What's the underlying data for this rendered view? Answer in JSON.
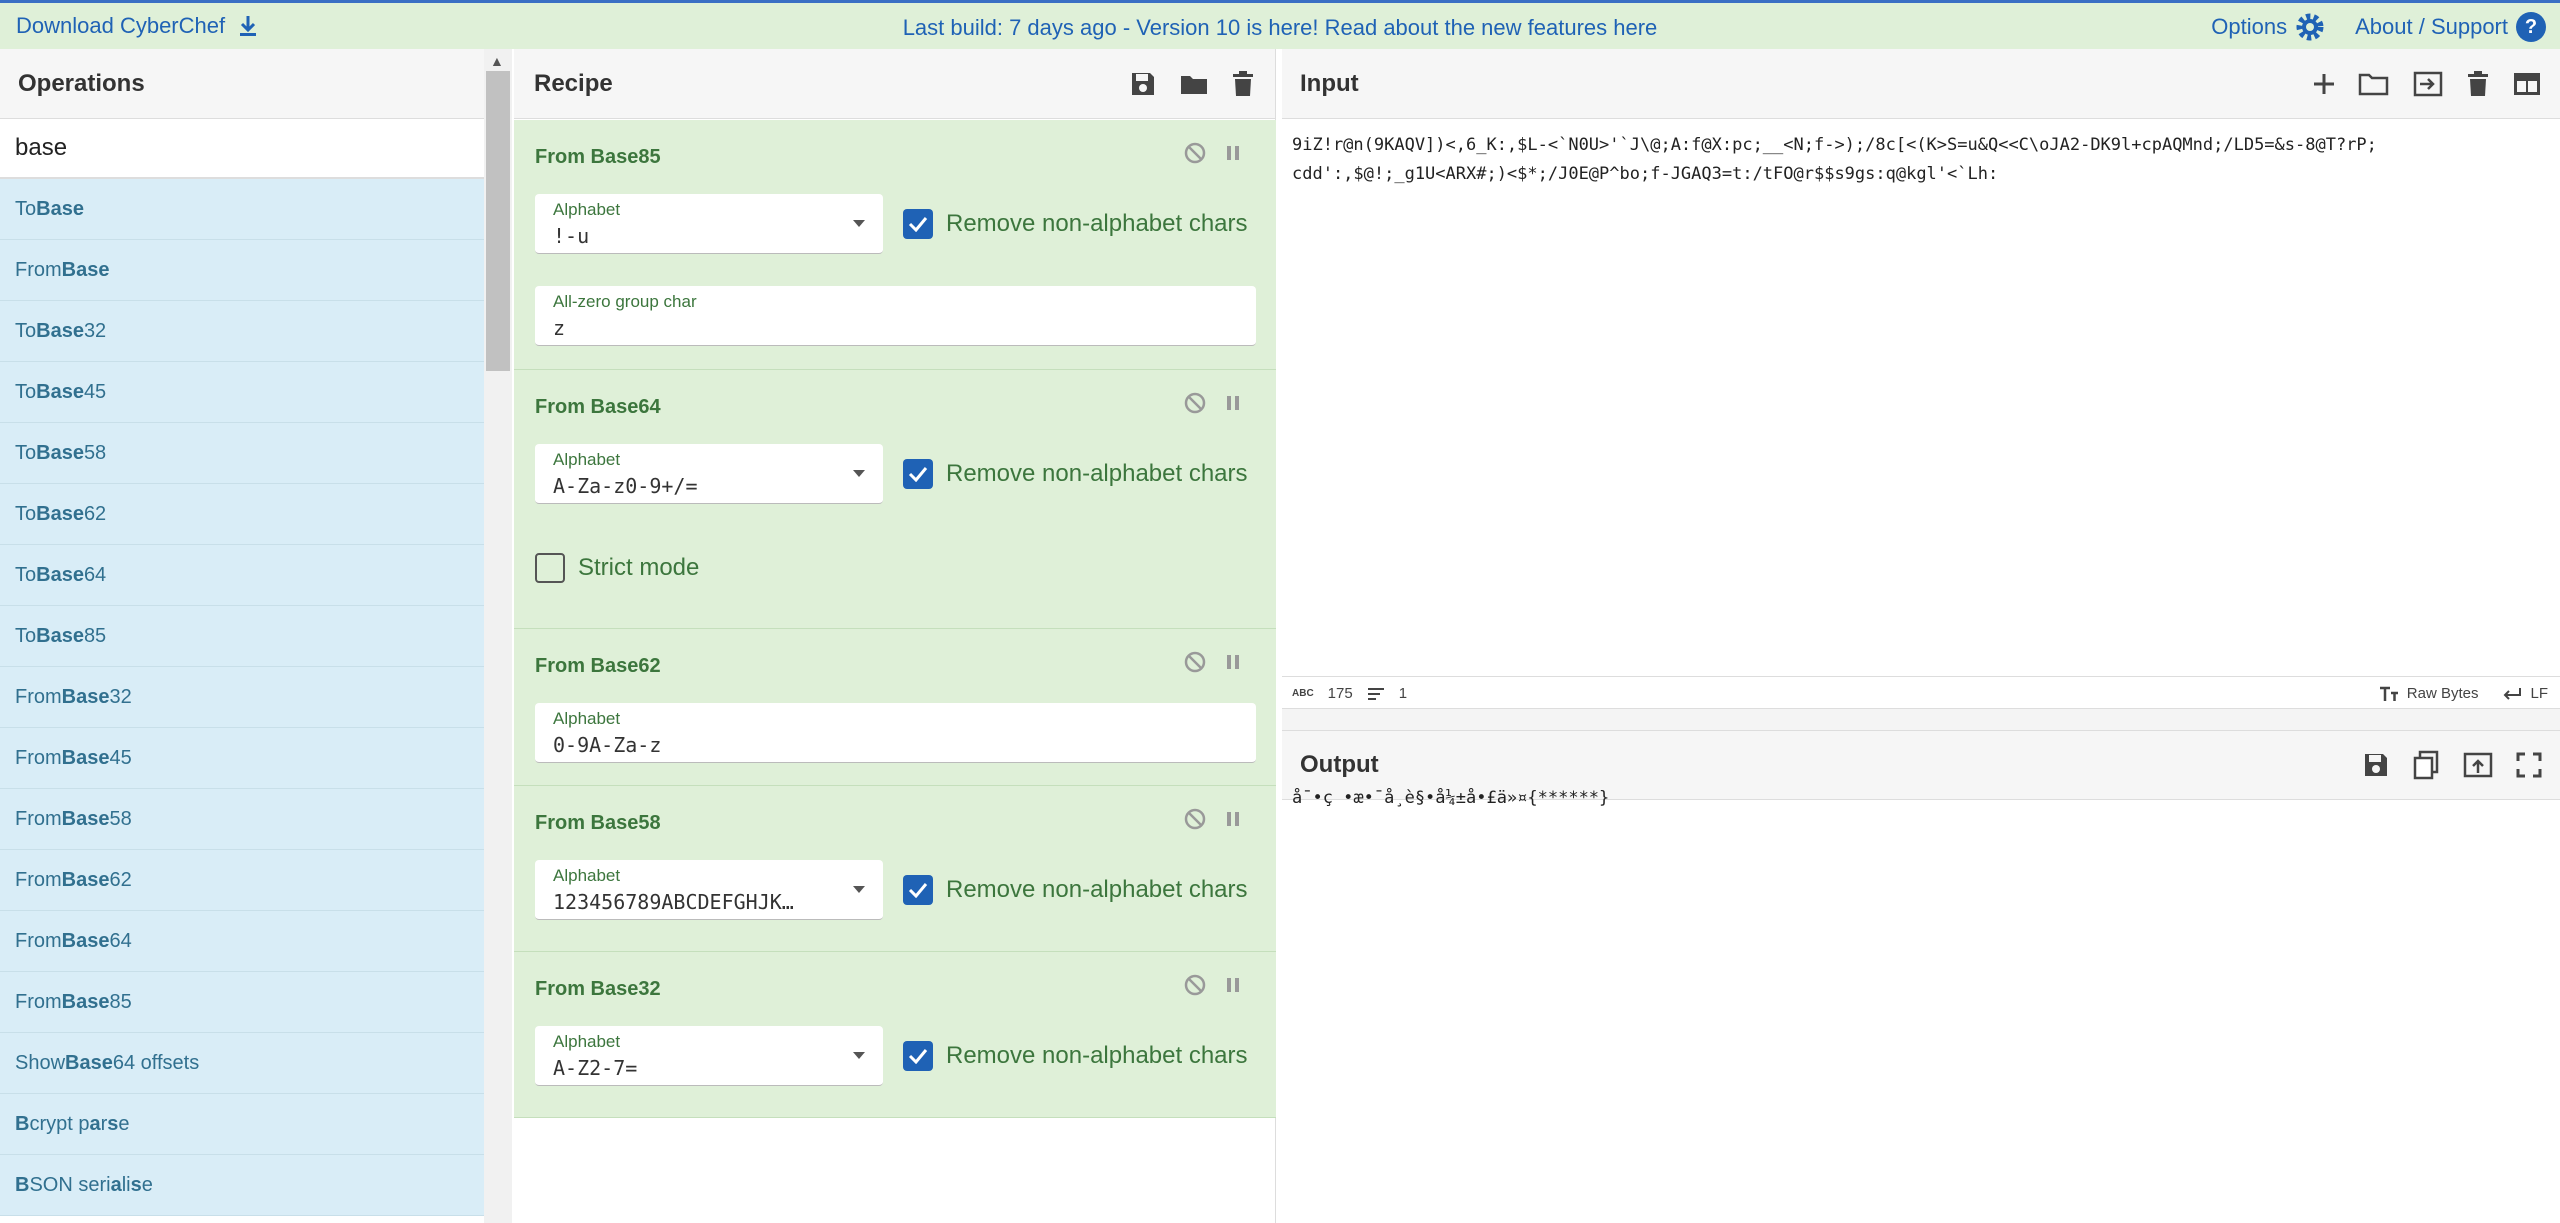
{
  "banner": {
    "download_label": "Download CyberChef",
    "center_text": "Last build: 7 days ago - Version 10 is here! Read about the new features here",
    "options_label": "Options",
    "about_label": "About / Support"
  },
  "operations": {
    "title": "Operations",
    "search_value": "base",
    "items": [
      {
        "pre": "To ",
        "bold": "Base",
        "post": ""
      },
      {
        "pre": "From ",
        "bold": "Base",
        "post": ""
      },
      {
        "pre": "To ",
        "bold": "Base",
        "post": "32"
      },
      {
        "pre": "To ",
        "bold": "Base",
        "post": "45"
      },
      {
        "pre": "To ",
        "bold": "Base",
        "post": "58"
      },
      {
        "pre": "To ",
        "bold": "Base",
        "post": "62"
      },
      {
        "pre": "To ",
        "bold": "Base",
        "post": "64"
      },
      {
        "pre": "To ",
        "bold": "Base",
        "post": "85"
      },
      {
        "pre": "From ",
        "bold": "Base",
        "post": "32"
      },
      {
        "pre": "From ",
        "bold": "Base",
        "post": "45"
      },
      {
        "pre": "From ",
        "bold": "Base",
        "post": "58"
      },
      {
        "pre": "From ",
        "bold": "Base",
        "post": "62"
      },
      {
        "pre": "From ",
        "bold": "Base",
        "post": "64"
      },
      {
        "pre": "From ",
        "bold": "Base",
        "post": "85"
      },
      {
        "pre": "Show ",
        "bold": "Base",
        "post": "64 offsets"
      },
      {
        "pre": "",
        "bold": "B",
        "post": "crypt p",
        "bold2": "a",
        "post2": "r",
        "bold3": "s",
        "post3": "e"
      },
      {
        "pre": "",
        "bold": "B",
        "post": "SON seri",
        "bold2": "a",
        "post2": "li",
        "bold3": "s",
        "post3": "e"
      }
    ]
  },
  "recipe": {
    "title": "Recipe",
    "ingredients": [
      {
        "name": "From Base85",
        "alphabet_label": "Alphabet",
        "alphabet_value": "!-u",
        "remove_label": "Remove non-alphabet chars",
        "zero_label": "All-zero group char",
        "zero_value": "z"
      },
      {
        "name": "From Base64",
        "alphabet_label": "Alphabet",
        "alphabet_value": "A-Za-z0-9+/=",
        "remove_label": "Remove non-alphabet chars",
        "strict_label": "Strict mode"
      },
      {
        "name": "From Base62",
        "alphabet_label": "Alphabet",
        "alphabet_value": "0-9A-Za-z"
      },
      {
        "name": "From Base58",
        "alphabet_label": "Alphabet",
        "alphabet_value": "123456789ABCDEFGHJK…",
        "remove_label": "Remove non-alphabet chars"
      },
      {
        "name": "From Base32",
        "alphabet_label": "Alphabet",
        "alphabet_value": "A-Z2-7=",
        "remove_label": "Remove non-alphabet chars"
      }
    ]
  },
  "input": {
    "title": "Input",
    "line1": "9iZ!r@n(9KAQV])<,6_K:,$L-<`N0U>'`J\\@;A:f@X:pc;__<N;f->);/8c[<(K>S=u&Q<<C\\oJA2-DK9l+cpAQMnd;/LD5=&s-8@T?rP;",
    "line2": "cdd':,$@!;_g1U<ARX#;)<$*;/J0E@P^bo;f-JGAQ3=t:/tFO@r$$s9gs:q@kgl'<`Lh:",
    "status": {
      "chars_label": "ABC",
      "chars": "175",
      "lines": "1",
      "encoding": "Raw Bytes",
      "eol": "LF"
    }
  },
  "output": {
    "title": "Output",
    "text": "å¯•ç •æ•¯å¸è§•å¼±å•£ä»¤{******}"
  },
  "colors": {
    "accent": "#1f62b5",
    "recipe_bg": "#dff0d8",
    "ops_bg": "#d9edf7"
  }
}
